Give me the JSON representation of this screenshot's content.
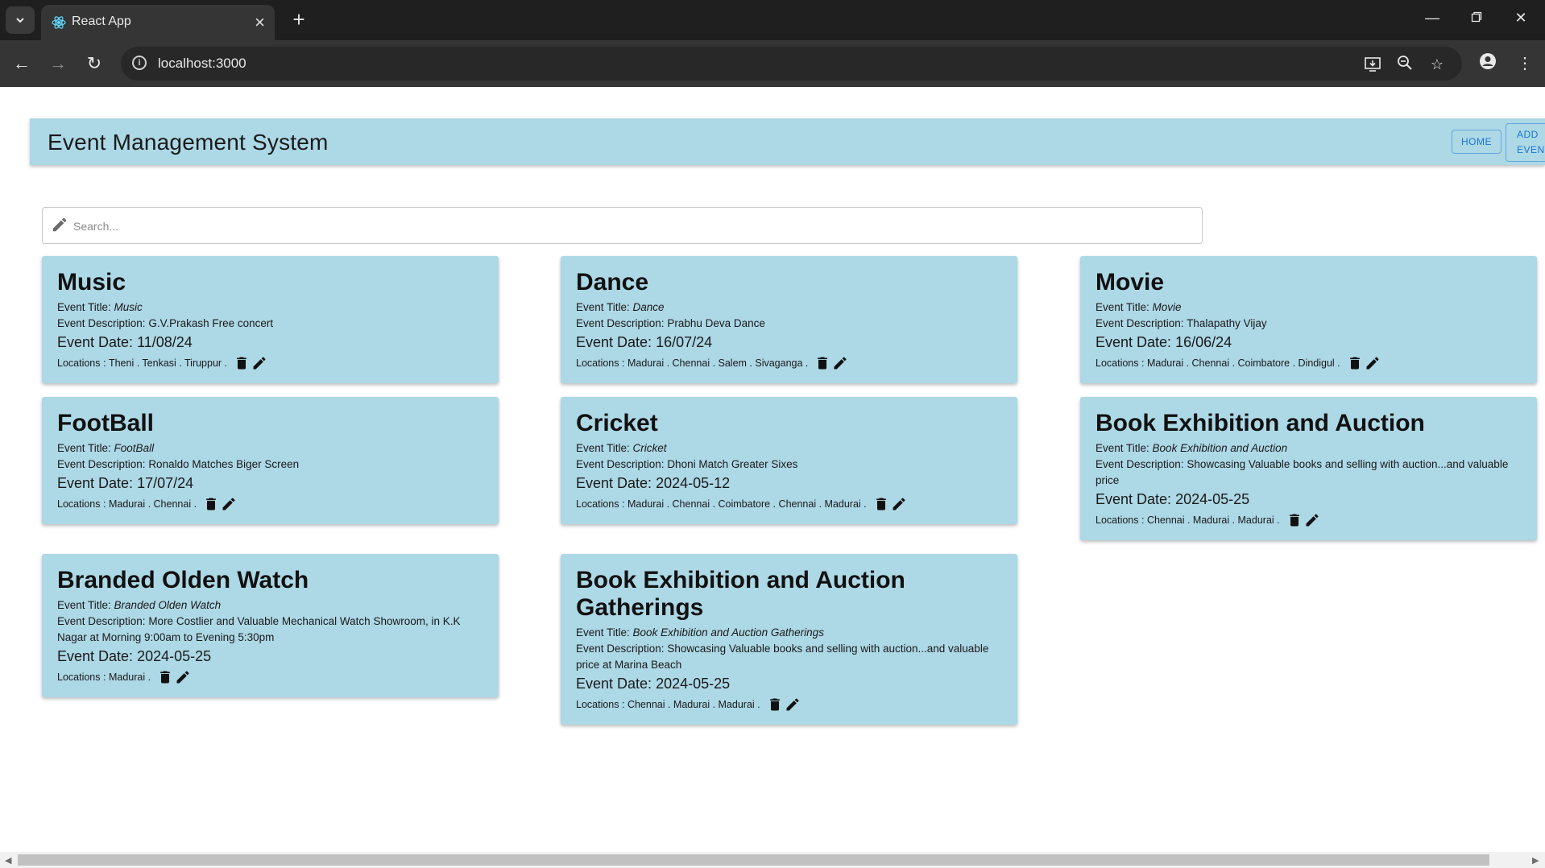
{
  "browser": {
    "tab_title": "React App",
    "url": "localhost:3000"
  },
  "app": {
    "title": "Event Management System",
    "nav": {
      "home": "HOME",
      "add_line1": "ADD",
      "add_line2": "EVENT"
    }
  },
  "search": {
    "placeholder": "Search..."
  },
  "labels": {
    "event_title": "Event Title: ",
    "event_description": "Event Description: ",
    "event_date": "Event Date: ",
    "locations": "Locations : "
  },
  "events": [
    {
      "name": "Music",
      "title": "Music",
      "description": "G.V.Prakash Free concert",
      "date": "11/08/24",
      "locations": "Theni . Tenkasi . Tiruppur ."
    },
    {
      "name": "Dance",
      "title": "Dance",
      "description": "Prabhu Deva Dance",
      "date": "16/07/24",
      "locations": "Madurai . Chennai . Salem . Sivaganga ."
    },
    {
      "name": "Movie",
      "title": "Movie",
      "description": "Thalapathy Vijay",
      "date": "16/06/24",
      "locations": "Madurai . Chennai . Coimbatore . Dindigul ."
    },
    {
      "name": "FootBall",
      "title": "FootBall",
      "description": "Ronaldo Matches Biger Screen",
      "date": "17/07/24",
      "locations": "Madurai . Chennai ."
    },
    {
      "name": "Cricket",
      "title": "Cricket",
      "description": "Dhoni Match Greater Sixes",
      "date": "2024-05-12",
      "locations": "Madurai . Chennai . Coimbatore . Chennai . Madurai ."
    },
    {
      "name": "Book Exhibition and Auction",
      "title": "Book Exhibition and Auction",
      "description": "Showcasing Valuable books and selling with auction...and valuable price",
      "date": "2024-05-25",
      "locations": "Chennai . Madurai . Madurai ."
    },
    {
      "name": "Branded Olden Watch",
      "title": "Branded Olden Watch",
      "description": "More Costlier and Valuable Mechanical Watch Showroom, in K.K Nagar at Morning 9:00am to Evening 5:30pm",
      "date": "2024-05-25",
      "locations": "Madurai ."
    },
    {
      "name": "Book Exhibition and Auction Gatherings",
      "title": "Book Exhibition and Auction Gatherings",
      "description": "Showcasing Valuable books and selling with auction...and valuable price at Marina Beach",
      "date": "2024-05-25",
      "locations": "Chennai . Madurai . Madurai ."
    }
  ],
  "colors": {
    "card_bg": "#add8e6",
    "appbar_bg": "#add8e6",
    "button_text": "#1976d2"
  }
}
